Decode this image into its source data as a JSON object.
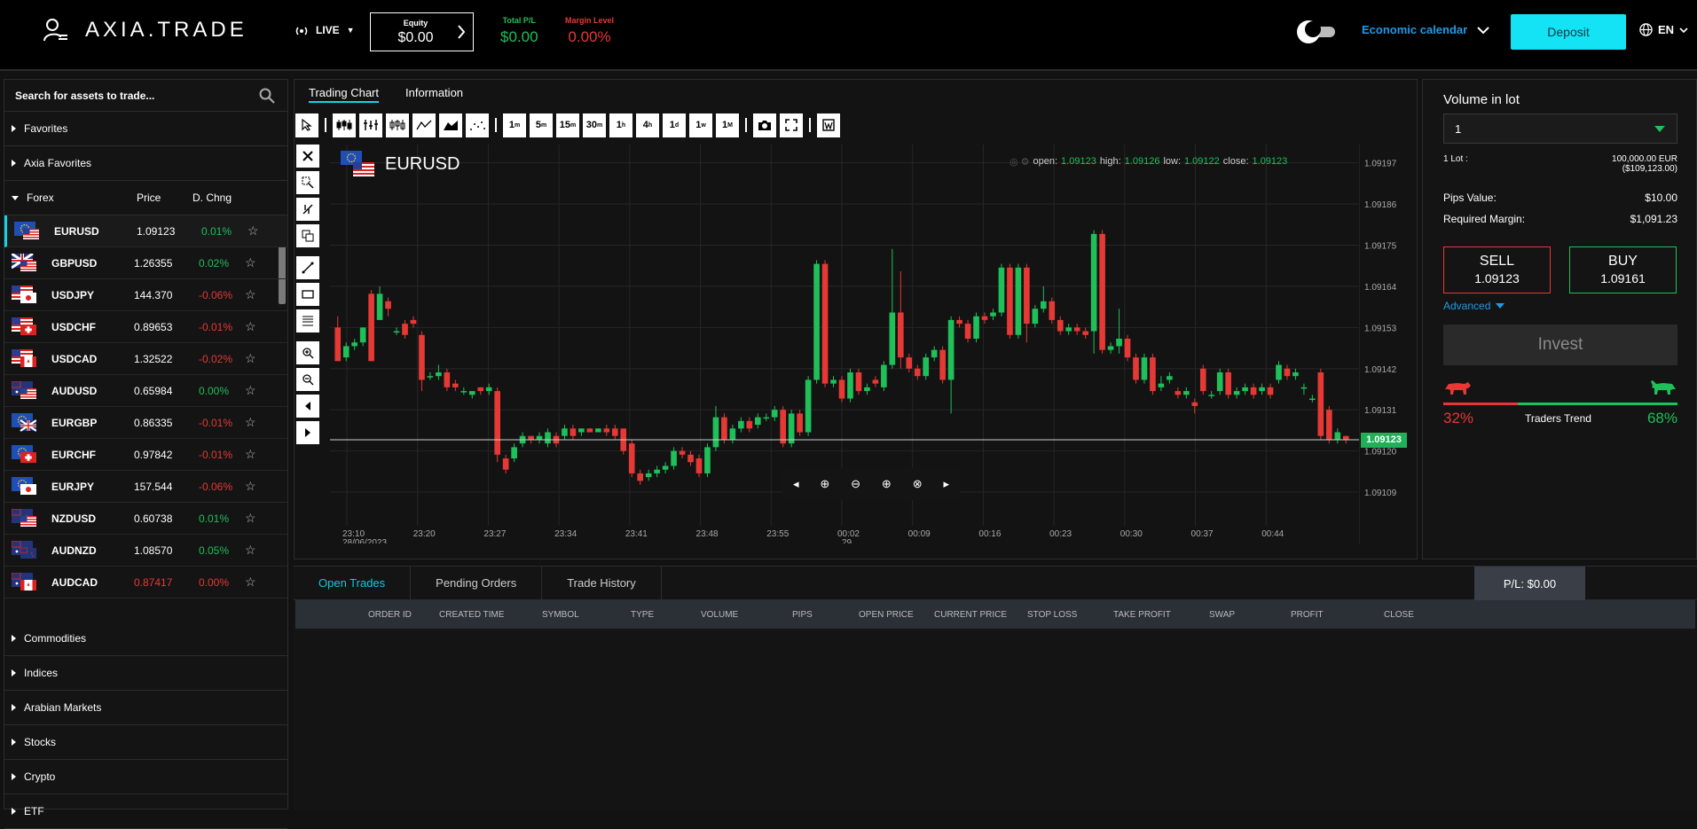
{
  "header": {
    "logo_text": "AXIA.TRADE",
    "mode": "LIVE",
    "equity_label": "Equity",
    "equity_value": "$0.00",
    "total_pl_label": "Total P/L",
    "total_pl_value": "$0.00",
    "margin_label": "Margin Level",
    "margin_value": "0.00%",
    "economic_calendar": "Economic calendar",
    "deposit": "Deposit",
    "language": "EN",
    "colors": {
      "green": "#1fbf5a",
      "red": "#e53935",
      "accent": "#14e3f5",
      "link": "#1e9be6"
    }
  },
  "sidebar": {
    "search_placeholder": "Search for assets to trade...",
    "sections_top": [
      "Favorites",
      "Axia Favorites"
    ],
    "forex": {
      "label": "Forex",
      "price_header": "Price",
      "change_header": "D. Chng",
      "rows": [
        {
          "symbol": "EURUSD",
          "price": "1.09123",
          "change": "0.01%",
          "dir": "up",
          "f1": "eu",
          "f2": "us"
        },
        {
          "symbol": "GBPUSD",
          "price": "1.26355",
          "change": "0.02%",
          "dir": "up",
          "f1": "gb",
          "f2": "us"
        },
        {
          "symbol": "USDJPY",
          "price": "144.370",
          "change": "-0.06%",
          "dir": "down",
          "f1": "us",
          "f2": "jp"
        },
        {
          "symbol": "USDCHF",
          "price": "0.89653",
          "change": "-0.01%",
          "dir": "down",
          "f1": "us",
          "f2": "ch"
        },
        {
          "symbol": "USDCAD",
          "price": "1.32522",
          "change": "-0.02%",
          "dir": "down",
          "f1": "us",
          "f2": "ca"
        },
        {
          "symbol": "AUDUSD",
          "price": "0.65984",
          "change": "0.00%",
          "dir": "up",
          "f1": "au",
          "f2": "us"
        },
        {
          "symbol": "EURGBP",
          "price": "0.86335",
          "change": "-0.01%",
          "dir": "down",
          "f1": "eu",
          "f2": "gb"
        },
        {
          "symbol": "EURCHF",
          "price": "0.97842",
          "change": "-0.01%",
          "dir": "down",
          "f1": "eu",
          "f2": "ch"
        },
        {
          "symbol": "EURJPY",
          "price": "157.544",
          "change": "-0.06%",
          "dir": "down",
          "f1": "eu",
          "f2": "jp"
        },
        {
          "symbol": "NZDUSD",
          "price": "0.60738",
          "change": "0.01%",
          "dir": "up",
          "f1": "nz",
          "f2": "us"
        },
        {
          "symbol": "AUDNZD",
          "price": "1.08570",
          "change": "0.05%",
          "dir": "up",
          "f1": "au",
          "f2": "nz"
        },
        {
          "symbol": "AUDCAD",
          "price": "0.87417",
          "change": "0.00%",
          "dir": "red",
          "f1": "au",
          "f2": "ca"
        }
      ]
    },
    "sections_bottom": [
      "Commodities",
      "Indices",
      "Arabian Markets",
      "Stocks",
      "Crypto",
      "ETF"
    ]
  },
  "chart": {
    "tabs": [
      "Trading Chart",
      "Information"
    ],
    "timeframes": [
      [
        "1",
        "m"
      ],
      [
        "5",
        "m"
      ],
      [
        "15",
        "m"
      ],
      [
        "30",
        "m"
      ],
      [
        "1",
        "h"
      ],
      [
        "4",
        "h"
      ],
      [
        "1",
        "d"
      ],
      [
        "1",
        "w"
      ],
      [
        "1",
        "M"
      ]
    ],
    "symbol": "EURUSD",
    "ohlc": {
      "open_label": "open:",
      "open": "1.09123",
      "high_label": "high:",
      "high": "1.09126",
      "low_label": "low:",
      "low": "1.09122",
      "close_label": "close:",
      "close": "1.09123"
    },
    "current_price": "1.09123"
  },
  "chart_data": {
    "type": "candlestick",
    "price_ticks": [
      "1.09197",
      "1.09186",
      "1.09175",
      "1.09164",
      "1.09153",
      "1.09142",
      "1.09131",
      "1.09120",
      "1.09109"
    ],
    "price_tick_values": [
      1.09197,
      1.09186,
      1.09175,
      1.09164,
      1.09153,
      1.09142,
      1.09131,
      1.0912,
      1.09109
    ],
    "time_ticks": [
      "23:10",
      "23:20",
      "23:27",
      "23:34",
      "23:41",
      "23:48",
      "23:55",
      "00:02",
      "00:09",
      "00:16",
      "00:23",
      "00:30",
      "00:37",
      "00:44"
    ],
    "date_labels": [
      "28/06/2023",
      "29"
    ],
    "ylim": [
      1.091,
      1.092
    ],
    "candles": [
      [
        1.09153,
        1.09144,
        1.09156,
        1.09144
      ],
      [
        1.09145,
        1.09148,
        1.09149,
        1.09144
      ],
      [
        1.09148,
        1.09149,
        1.0915,
        1.09147
      ],
      [
        1.09149,
        1.09153,
        1.09153,
        1.09148
      ],
      [
        1.09162,
        1.09144,
        1.09163,
        1.09144
      ],
      [
        1.09155,
        1.09162,
        1.09164,
        1.09155
      ],
      [
        1.0916,
        1.09158,
        1.09161,
        1.09156
      ],
      [
        1.09152,
        1.09152,
        1.09153,
        1.09151
      ],
      [
        1.09154,
        1.09151,
        1.09155,
        1.0915
      ],
      [
        1.09155,
        1.09154,
        1.09156,
        1.09153
      ],
      [
        1.09151,
        1.09139,
        1.09152,
        1.09136
      ],
      [
        1.0914,
        1.0914,
        1.09141,
        1.09139
      ],
      [
        1.0914,
        1.09141,
        1.09143,
        1.09139
      ],
      [
        1.09141,
        1.09137,
        1.09142,
        1.09136
      ],
      [
        1.09138,
        1.09137,
        1.09139,
        1.09136
      ],
      [
        1.09136,
        1.09136,
        1.09137,
        1.09135
      ],
      [
        1.09135,
        1.09136,
        1.09136,
        1.09134
      ],
      [
        1.09137,
        1.09136,
        1.09137,
        1.09135
      ],
      [
        1.09136,
        1.09137,
        1.09138,
        1.09135
      ],
      [
        1.09136,
        1.09119,
        1.09137,
        1.09117
      ],
      [
        1.09118,
        1.09115,
        1.09119,
        1.09114
      ],
      [
        1.09118,
        1.09121,
        1.09122,
        1.09117
      ],
      [
        1.09122,
        1.09124,
        1.09125,
        1.09121
      ],
      [
        1.09124,
        1.09123,
        1.09124,
        1.09122
      ],
      [
        1.09123,
        1.09124,
        1.09125,
        1.09122
      ],
      [
        1.09122,
        1.09125,
        1.09126,
        1.09121
      ],
      [
        1.09124,
        1.09122,
        1.09125,
        1.09121
      ],
      [
        1.09124,
        1.09126,
        1.09127,
        1.09123
      ],
      [
        1.09126,
        1.09124,
        1.09127,
        1.09123
      ],
      [
        1.09125,
        1.09126,
        1.09126,
        1.09124
      ],
      [
        1.09126,
        1.09125,
        1.09126,
        1.09125
      ],
      [
        1.09125,
        1.09126,
        1.09126,
        1.09125
      ],
      [
        1.09126,
        1.09125,
        1.09127,
        1.09124
      ],
      [
        1.09126,
        1.09124,
        1.09127,
        1.09123
      ],
      [
        1.09126,
        1.0912,
        1.09126,
        1.09119
      ],
      [
        1.09122,
        1.09114,
        1.09123,
        1.09113
      ],
      [
        1.09114,
        1.09112,
        1.09115,
        1.09111
      ],
      [
        1.09113,
        1.09114,
        1.09115,
        1.09112
      ],
      [
        1.09114,
        1.09115,
        1.09116,
        1.09113
      ],
      [
        1.09115,
        1.09116,
        1.09117,
        1.09114
      ],
      [
        1.09116,
        1.0912,
        1.09121,
        1.09115
      ],
      [
        1.0912,
        1.09119,
        1.09121,
        1.09118
      ],
      [
        1.09119,
        1.09117,
        1.0912,
        1.09116
      ],
      [
        1.09118,
        1.09114,
        1.09119,
        1.09113
      ],
      [
        1.09114,
        1.09121,
        1.09122,
        1.09113
      ],
      [
        1.09121,
        1.09129,
        1.09132,
        1.0912
      ],
      [
        1.09129,
        1.09123,
        1.0913,
        1.09122
      ],
      [
        1.09123,
        1.09126,
        1.09127,
        1.09122
      ],
      [
        1.09126,
        1.09128,
        1.09129,
        1.09125
      ],
      [
        1.09128,
        1.09126,
        1.09129,
        1.09125
      ],
      [
        1.09127,
        1.09129,
        1.0913,
        1.09126
      ],
      [
        1.09129,
        1.09129,
        1.0913,
        1.09128
      ],
      [
        1.09129,
        1.09131,
        1.09132,
        1.09128
      ],
      [
        1.09131,
        1.09122,
        1.09132,
        1.09121
      ],
      [
        1.09122,
        1.0913,
        1.09131,
        1.09121
      ],
      [
        1.0913,
        1.09125,
        1.09131,
        1.09124
      ],
      [
        1.09125,
        1.09139,
        1.0914,
        1.09124
      ],
      [
        1.09139,
        1.0917,
        1.09171,
        1.09138
      ],
      [
        1.0917,
        1.09138,
        1.09171,
        1.09137
      ],
      [
        1.09138,
        1.09139,
        1.0914,
        1.09137
      ],
      [
        1.09139,
        1.09134,
        1.0914,
        1.09133
      ],
      [
        1.09134,
        1.09141,
        1.09142,
        1.09133
      ],
      [
        1.09141,
        1.09136,
        1.09142,
        1.09135
      ],
      [
        1.09136,
        1.09137,
        1.09138,
        1.09135
      ],
      [
        1.09139,
        1.09138,
        1.0914,
        1.09137
      ],
      [
        1.09137,
        1.09143,
        1.09144,
        1.09136
      ],
      [
        1.09143,
        1.09157,
        1.09174,
        1.09142
      ],
      [
        1.09157,
        1.09145,
        1.09168,
        1.09142
      ],
      [
        1.09145,
        1.09142,
        1.09146,
        1.09141
      ],
      [
        1.09142,
        1.0914,
        1.09143,
        1.09139
      ],
      [
        1.0914,
        1.09145,
        1.09146,
        1.09139
      ],
      [
        1.09145,
        1.09147,
        1.09148,
        1.09144
      ],
      [
        1.09147,
        1.09139,
        1.09148,
        1.09138
      ],
      [
        1.09139,
        1.09155,
        1.09156,
        1.0913
      ],
      [
        1.09155,
        1.09154,
        1.09156,
        1.09153
      ],
      [
        1.09154,
        1.0915,
        1.09155,
        1.09149
      ],
      [
        1.0915,
        1.09156,
        1.09157,
        1.09149
      ],
      [
        1.09156,
        1.09155,
        1.09157,
        1.09154
      ],
      [
        1.09156,
        1.09157,
        1.09158,
        1.09155
      ],
      [
        1.09157,
        1.09169,
        1.0917,
        1.09156
      ],
      [
        1.09169,
        1.09151,
        1.0917,
        1.0915
      ],
      [
        1.09151,
        1.09169,
        1.0917,
        1.0915
      ],
      [
        1.09169,
        1.09154,
        1.0917,
        1.09149
      ],
      [
        1.09154,
        1.09158,
        1.09159,
        1.09153
      ],
      [
        1.09158,
        1.0916,
        1.09164,
        1.09157
      ],
      [
        1.0916,
        1.09155,
        1.09161,
        1.09154
      ],
      [
        1.09155,
        1.09152,
        1.09156,
        1.09151
      ],
      [
        1.09152,
        1.09153,
        1.09154,
        1.09151
      ],
      [
        1.09153,
        1.09152,
        1.09154,
        1.09151
      ],
      [
        1.09152,
        1.09151,
        1.09153,
        1.0915
      ],
      [
        1.09152,
        1.09178,
        1.09179,
        1.09146
      ],
      [
        1.09178,
        1.09147,
        1.09179,
        1.09146
      ],
      [
        1.09147,
        1.09148,
        1.09149,
        1.09146
      ],
      [
        1.09148,
        1.0915,
        1.09158,
        1.09146
      ],
      [
        1.0915,
        1.09145,
        1.09151,
        1.09144
      ],
      [
        1.09145,
        1.09139,
        1.09146,
        1.09138
      ],
      [
        1.09139,
        1.09145,
        1.09146,
        1.09138
      ],
      [
        1.09145,
        1.09136,
        1.09146,
        1.09135
      ],
      [
        1.09137,
        1.09138,
        1.0914,
        1.09136
      ],
      [
        1.09139,
        1.0914,
        1.09141,
        1.09138
      ],
      [
        1.09136,
        1.09135,
        1.09137,
        1.09134
      ],
      [
        1.09135,
        1.09136,
        1.09137,
        1.09134
      ],
      [
        1.09133,
        1.09132,
        1.09134,
        1.0913
      ],
      [
        1.09142,
        1.09136,
        1.09143,
        1.09135
      ],
      [
        1.09135,
        1.09135,
        1.09136,
        1.09134
      ],
      [
        1.09136,
        1.09141,
        1.09142,
        1.09135
      ],
      [
        1.09141,
        1.09135,
        1.09142,
        1.09134
      ],
      [
        1.09135,
        1.09136,
        1.09137,
        1.09134
      ],
      [
        1.09136,
        1.09137,
        1.09138,
        1.09135
      ],
      [
        1.09137,
        1.09135,
        1.09138,
        1.09134
      ],
      [
        1.09136,
        1.09137,
        1.09138,
        1.09135
      ],
      [
        1.09137,
        1.09135,
        1.09138,
        1.09134
      ],
      [
        1.09139,
        1.09143,
        1.09144,
        1.09138
      ],
      [
        1.09142,
        1.0914,
        1.09143,
        1.09139
      ],
      [
        1.0914,
        1.09141,
        1.09142,
        1.09139
      ],
      [
        1.09137,
        1.09137,
        1.09138,
        1.09135
      ],
      [
        1.09134,
        1.09134,
        1.09135,
        1.09133
      ],
      [
        1.09141,
        1.09124,
        1.09142,
        1.09123
      ],
      [
        1.09131,
        1.09123,
        1.09132,
        1.09122
      ],
      [
        1.09123,
        1.09125,
        1.09126,
        1.09122
      ],
      [
        1.09124,
        1.09123,
        1.09124,
        1.09122
      ]
    ]
  },
  "bottom": {
    "tabs": [
      "Open Trades",
      "Pending Orders",
      "Trade History"
    ],
    "pl": "P/L:  $0.00",
    "columns": [
      "ORDER ID",
      "CREATED TIME",
      "SYMBOL",
      "TYPE",
      "VOLUME",
      "PIPS",
      "OPEN PRICE",
      "CURRENT PRICE",
      "STOP LOSS",
      "TAKE PROFIT",
      "SWAP",
      "PROFIT",
      "CLOSE"
    ]
  },
  "order_panel": {
    "volume_label": "Volume in lot",
    "volume_value": "1",
    "lot_label": "1 Lot :",
    "lot_value_1": "100,000.00 EUR",
    "lot_value_2": "($109,123.00)",
    "pips_label": "Pips Value:",
    "pips_value": "$10.00",
    "margin_label": "Required Margin:",
    "margin_value": "$1,091.23",
    "sell_label": "SELL",
    "sell_price": "1.09123",
    "buy_label": "BUY",
    "buy_price": "1.09161",
    "advanced": "Advanced",
    "invest": "Invest",
    "bear_pct": "32%",
    "bull_pct": "68%",
    "bear_fraction": 0.32,
    "trend_label": "Traders Trend"
  }
}
